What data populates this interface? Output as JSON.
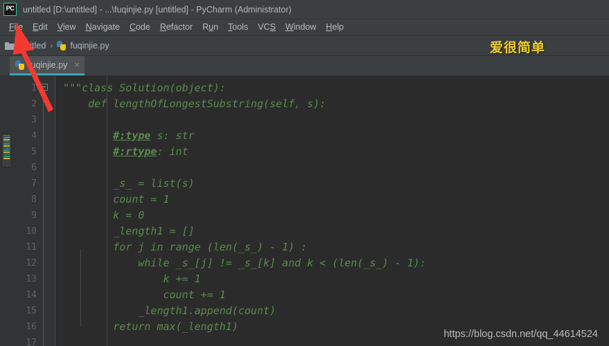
{
  "window": {
    "app_icon": "pycharm-logo-icon",
    "logo_text": "PC",
    "title": "untitled [D:\\untitled] - ...\\fuqinjie.py [untitled] - PyCharm (Administrator)"
  },
  "menubar": {
    "items": [
      {
        "mnemonic": "F",
        "rest": "ile",
        "name": "file"
      },
      {
        "mnemonic": "E",
        "rest": "dit",
        "name": "edit"
      },
      {
        "mnemonic": "V",
        "rest": "iew",
        "name": "view"
      },
      {
        "mnemonic": "N",
        "rest": "avigate",
        "name": "navigate"
      },
      {
        "mnemonic": "C",
        "rest": "ode",
        "name": "code"
      },
      {
        "mnemonic": "R",
        "rest": "efactor",
        "name": "refactor"
      },
      {
        "mnemonic": "R",
        "rest": "un",
        "name": "run",
        "mn_index": 1
      },
      {
        "mnemonic": "T",
        "rest": "ools",
        "name": "tools"
      },
      {
        "mnemonic": "VCS",
        "rest": "",
        "name": "vcs"
      },
      {
        "mnemonic": "W",
        "rest": "indow",
        "name": "window"
      },
      {
        "mnemonic": "H",
        "rest": "elp",
        "name": "help"
      }
    ]
  },
  "breadcrumb": {
    "project": "untitled",
    "separator": "›",
    "file": "fuqinjie.py"
  },
  "banner": {
    "text": "爱很简单",
    "color": "#f2d027"
  },
  "tabs": [
    {
      "label": "fuqinjie.py",
      "close": "×",
      "active": true
    }
  ],
  "editor": {
    "line_numbers": [
      "1",
      "2",
      "3",
      "4",
      "5",
      "6",
      "7",
      "8",
      "9",
      "10",
      "11",
      "12",
      "13",
      "14",
      "15",
      "16",
      "17"
    ],
    "lines": [
      {
        "n": 1,
        "segments": [
          {
            "t": "\"\"\"class Solution(object):"
          }
        ]
      },
      {
        "n": 2,
        "segments": [
          {
            "t": "    def lengthOfLongestSubstring(self, s):"
          }
        ]
      },
      {
        "n": 3,
        "segments": [
          {
            "t": ""
          }
        ]
      },
      {
        "n": 4,
        "segments": [
          {
            "t": "        "
          },
          {
            "t": "#:type",
            "style": "ul"
          },
          {
            "t": " s: str"
          }
        ]
      },
      {
        "n": 5,
        "segments": [
          {
            "t": "        "
          },
          {
            "t": "#:rtype",
            "style": "ul"
          },
          {
            "t": ": int"
          }
        ]
      },
      {
        "n": 6,
        "segments": [
          {
            "t": ""
          }
        ]
      },
      {
        "n": 7,
        "segments": [
          {
            "t": "        _s_ = list(s)"
          }
        ]
      },
      {
        "n": 8,
        "segments": [
          {
            "t": "        count = 1"
          }
        ]
      },
      {
        "n": 9,
        "segments": [
          {
            "t": "        k = 0"
          }
        ]
      },
      {
        "n": 10,
        "segments": [
          {
            "t": "        _length1 = []"
          }
        ]
      },
      {
        "n": 11,
        "segments": [
          {
            "t": "        for j in range (len(_s_) - 1) :"
          }
        ]
      },
      {
        "n": 12,
        "segments": [
          {
            "t": "            while _s_[j] != _s_[k] and k < (len(_s_) - 1):"
          }
        ]
      },
      {
        "n": 13,
        "segments": [
          {
            "t": "                k += 1"
          }
        ]
      },
      {
        "n": 14,
        "segments": [
          {
            "t": "                count += 1"
          }
        ]
      },
      {
        "n": 15,
        "segments": [
          {
            "t": "            _length1.append(count)"
          }
        ]
      },
      {
        "n": 16,
        "segments": [
          {
            "t": "        return max(_length1)"
          }
        ]
      },
      {
        "n": 17,
        "segments": [
          {
            "t": ""
          }
        ]
      }
    ],
    "fold_marker": "collapse-fold-icon",
    "code_color": "#5d8a4e",
    "background": "#2b2b2b",
    "gutter_background": "#313335"
  },
  "annotation": {
    "arrow_name": "red-pointer-arrow",
    "color": "#f23a30",
    "points_to": "file-menu"
  },
  "watermark": {
    "text": "https://blog.csdn.net/qq_44614524"
  }
}
